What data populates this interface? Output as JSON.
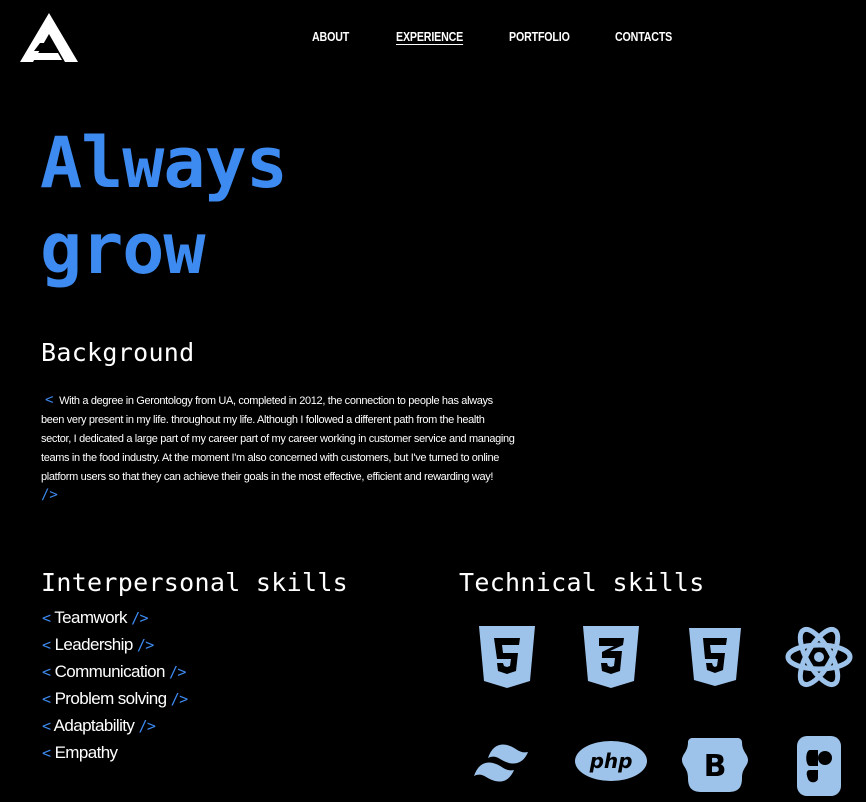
{
  "logo": {
    "icon": "a-logo-icon",
    "alt": "Logo"
  },
  "nav": {
    "items": [
      {
        "label": "ABOUT",
        "active": false
      },
      {
        "label": "EXPERIENCE",
        "active": true
      },
      {
        "label": "PORTFOLIO",
        "active": false
      },
      {
        "label": "CONTACTS",
        "active": false
      }
    ]
  },
  "hero": {
    "line1": "Always",
    "line2": "grow"
  },
  "background": {
    "title": "Background",
    "open_tag": "<",
    "close_tag": "/>",
    "text": "With a degree in Gerontology from UA, completed in 2012, the connection to people has always been very present in my life. throughout my life. Although I followed a different path from the health sector, I dedicated a large part of my career part of my career working in customer service and managing teams in the food industry. At the moment I'm also concerned with customers, but I've turned to online platform users so that they can achieve their goals in the most effective, efficient and rewarding way!"
  },
  "interpersonal": {
    "title": "Interpersonal skills",
    "open_tag": "<",
    "close_tag": "/>",
    "items": [
      "Teamwork",
      "Leadership",
      "Communication",
      "Problem solving",
      "Adaptability",
      "Empathy"
    ]
  },
  "technical": {
    "title": "Technical skills",
    "icons": [
      "html5-icon",
      "css3-icon",
      "html5-icon",
      "react-icon",
      "tailwind-icon",
      "php-icon",
      "bootstrap-icon",
      "figma-icon"
    ]
  },
  "colors": {
    "accent": "#3d8af0",
    "icon": "#9ec3ea",
    "background": "#000000",
    "text": "#ffffff"
  }
}
